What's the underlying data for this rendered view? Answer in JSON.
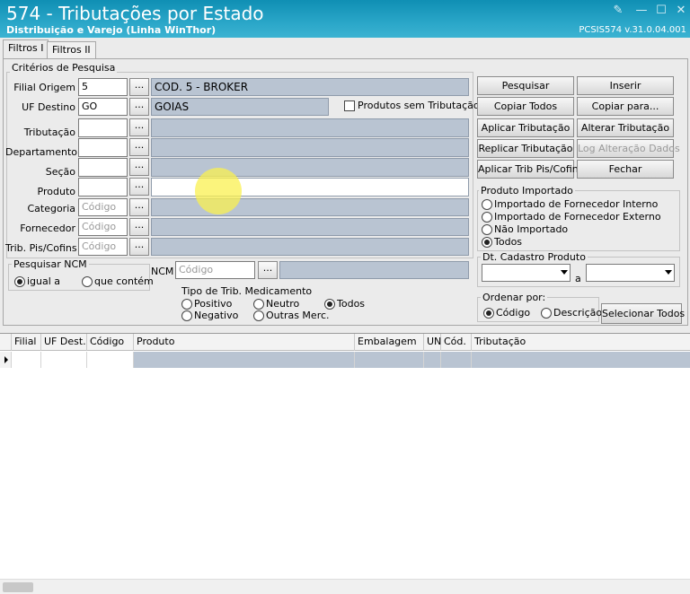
{
  "window": {
    "title": "574 - Tributações por Estado",
    "subtitle": "Distribuição e Varejo (Linha WinThor)",
    "version": "PCSIS574  v.31.0.04.001"
  },
  "tabs": [
    "Filtros I",
    "Filtros II"
  ],
  "criteria": {
    "group_title": "Critérios de Pesquisa",
    "filial_label": "Filial Origem",
    "filial_value": "5",
    "filial_desc": "COD. 5 - BROKER",
    "uf_label": "UF Destino",
    "uf_value": "GO",
    "uf_desc": "GOIAS",
    "sem_trib_label": "Produtos sem Tributação",
    "tributacao_label": "Tributação",
    "departamento_label": "Departamento",
    "secao_label": "Seção",
    "produto_label": "Produto",
    "categoria_label": "Categoria",
    "categoria_placeholder": "Código",
    "fornecedor_label": "Fornecedor",
    "fornecedor_placeholder": "Código",
    "trib_pis_label": "Trib. Pis/Cofins",
    "trib_pis_placeholder": "Código",
    "ncm_label": "NCM",
    "ncm_placeholder": "Código",
    "dots": "..."
  },
  "pesquisar_ncm": {
    "title": "Pesquisar NCM",
    "opt1": "igual a",
    "opt2": "que contém"
  },
  "medicamento": {
    "title": "Tipo de Trib. Medicamento",
    "positivo": "Positivo",
    "neutro": "Neutro",
    "todos": "Todos",
    "negativo": "Negativo",
    "outras": "Outras Merc."
  },
  "buttons": {
    "pesquisar": "Pesquisar",
    "inserir": "Inserir",
    "copiar_todos": "Copiar Todos",
    "copiar_para": "Copiar para...",
    "aplicar_trib": "Aplicar Tributação",
    "alterar_trib": "Alterar Tributação",
    "replicar_trib": "Replicar Tributação",
    "log_alteracao": "Log Alteração Dados",
    "aplicar_pis": "Aplicar Trib Pis/Cofins",
    "fechar": "Fechar",
    "selecionar_todos": "Selecionar Todos"
  },
  "produto_importado": {
    "title": "Produto Importado",
    "opt1": "Importado de Fornecedor Interno",
    "opt2": "Importado de Fornecedor Externo",
    "opt3": "Não Importado",
    "opt4": "Todos"
  },
  "dt_cadastro": {
    "title": "Dt. Cadastro Produto",
    "sep": "a"
  },
  "ordenar": {
    "title": "Ordenar por:",
    "opt1": "Código",
    "opt2": "Descrição"
  },
  "grid": {
    "columns": [
      "Filial",
      "UF Dest.",
      "Código",
      "Produto",
      "Embalagem",
      "UN",
      "Cód.",
      "Tributação"
    ]
  },
  "colors": {
    "titlebar": "#1b9bbf",
    "readonly_field": "#b9c4d2"
  }
}
